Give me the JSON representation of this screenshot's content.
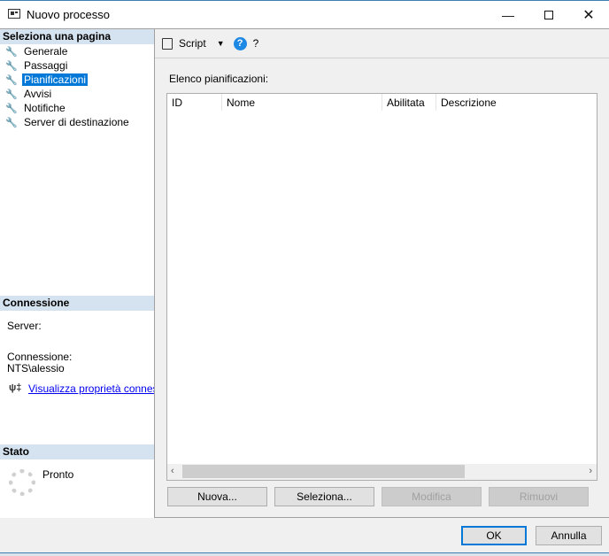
{
  "window": {
    "title": "Nuovo processo"
  },
  "left": {
    "select_header": "Seleziona una pagina",
    "pages": [
      {
        "label": "Generale"
      },
      {
        "label": "Passaggi"
      },
      {
        "label": "Pianificazioni",
        "selected": true
      },
      {
        "label": "Avvisi"
      },
      {
        "label": "Notifiche"
      },
      {
        "label": "Server di destinazione"
      }
    ],
    "connection_header": "Connessione",
    "server_label": "Server:",
    "connection_label": "Connessione:",
    "connection_value": "NTS\\alessio",
    "connection_link": "Visualizza proprietà connessione",
    "status_header": "Stato",
    "status_value": "Pronto"
  },
  "toolbar": {
    "script_label": "Script",
    "help_label": "?"
  },
  "main": {
    "list_label": "Elenco pianificazioni:",
    "columns": [
      "ID",
      "Nome",
      "Abilitata",
      "Descrizione"
    ],
    "buttons": {
      "new": "Nuova...",
      "select": "Seleziona...",
      "edit": "Modifica",
      "remove": "Rimuovi"
    }
  },
  "footer": {
    "ok": "OK",
    "cancel": "Annulla"
  }
}
